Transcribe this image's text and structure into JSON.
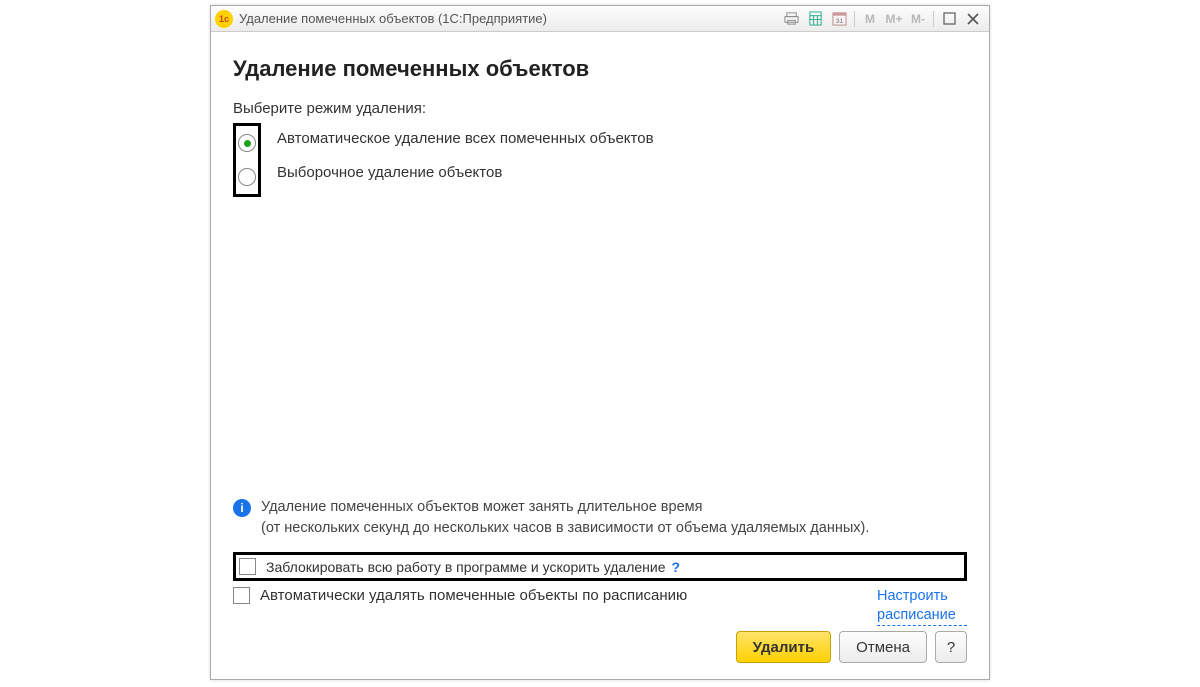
{
  "titlebar": {
    "title": "Удаление помеченных объектов  (1С:Предприятие)",
    "m": "M",
    "mplus": "M+",
    "mminus": "M-"
  },
  "heading": "Удаление помеченных объектов",
  "prompt": "Выберите режим удаления:",
  "radios": {
    "auto": "Автоматическое удаление всех помеченных объектов",
    "selective": "Выборочное удаление объектов"
  },
  "info": {
    "line1": "Удаление помеченных объектов может занять длительное время",
    "line2": "(от нескольких секунд до нескольких часов в зависимости от объема удаляемых данных)."
  },
  "checks": {
    "block": "Заблокировать всю работу в программе и ускорить удаление",
    "schedule": "Автоматически удалять помеченные объекты по расписанию",
    "schedule_link": "Настроить расписание",
    "qmark": "?"
  },
  "footer": {
    "delete": "Удалить",
    "cancel": "Отмена",
    "help": "?"
  }
}
